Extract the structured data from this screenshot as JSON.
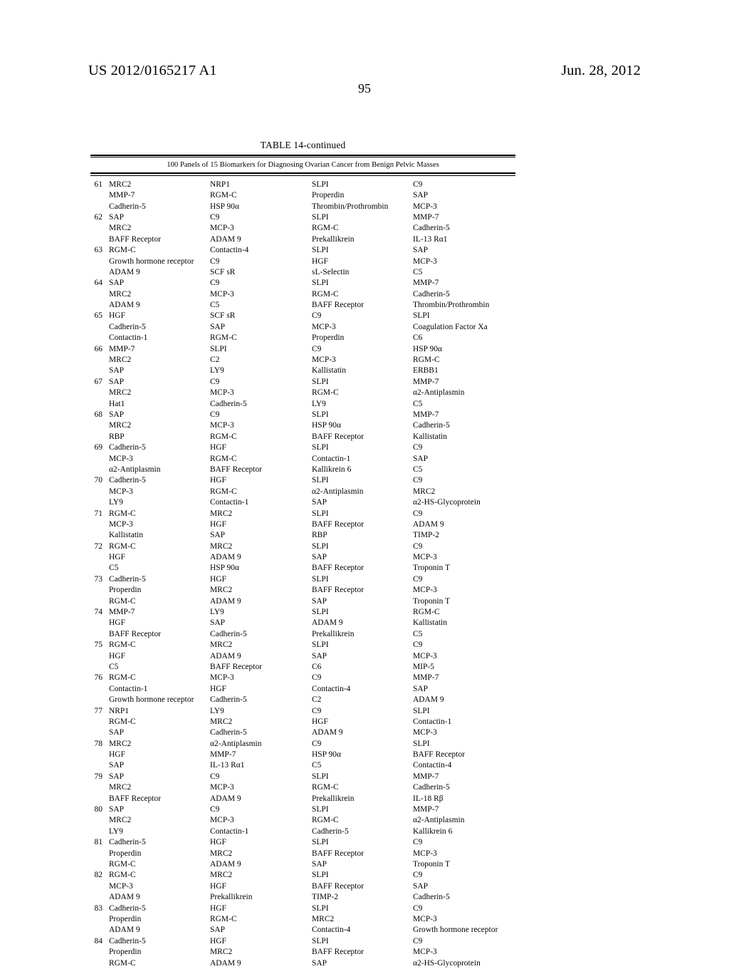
{
  "header": {
    "publication_number": "US 2012/0165217 A1",
    "publication_date": "Jun. 28, 2012",
    "page_number": "95"
  },
  "table": {
    "title": "TABLE 14-continued",
    "caption": "100 Panels of 15 Biomarkers for Diagnosing Ovarian Cancer from Benign Pelvic Masses",
    "panels": [
      {
        "index": "61",
        "lines": [
          [
            "MRC2",
            "NRP1",
            "SLPI",
            "C9"
          ],
          [
            "MMP-7",
            "RGM-C",
            "Properdin",
            "SAP"
          ],
          [
            "Cadherin-5",
            "HSP 90α",
            "Thrombin/Prothrombin",
            "MCP-3"
          ]
        ]
      },
      {
        "index": "62",
        "lines": [
          [
            "SAP",
            "C9",
            "SLPI",
            "MMP-7"
          ],
          [
            "MRC2",
            "MCP-3",
            "RGM-C",
            "Cadherin-5"
          ],
          [
            "BAFF Receptor",
            "ADAM 9",
            "Prekallikrein",
            "IL-13 Rα1"
          ]
        ]
      },
      {
        "index": "63",
        "lines": [
          [
            "RGM-C",
            "Contactin-4",
            "SLPI",
            "SAP"
          ],
          [
            "Growth hormone receptor",
            "C9",
            "HGF",
            "MCP-3"
          ],
          [
            "ADAM 9",
            "SCF sR",
            "sL-Selectin",
            "C5"
          ]
        ]
      },
      {
        "index": "64",
        "lines": [
          [
            "SAP",
            "C9",
            "SLPI",
            "MMP-7"
          ],
          [
            "MRC2",
            "MCP-3",
            "RGM-C",
            "Cadherin-5"
          ],
          [
            "ADAM 9",
            "C5",
            "BAFF Receptor",
            "Thrombin/Prothrombin"
          ]
        ]
      },
      {
        "index": "65",
        "lines": [
          [
            "HGF",
            "SCF sR",
            "C9",
            "SLPI"
          ],
          [
            "Cadherin-5",
            "SAP",
            "MCP-3",
            "Coagulation Factor Xa"
          ],
          [
            "Contactin-1",
            "RGM-C",
            "Properdin",
            "C6"
          ]
        ]
      },
      {
        "index": "66",
        "lines": [
          [
            "MMP-7",
            "SLPI",
            "C9",
            "HSP 90α"
          ],
          [
            "MRC2",
            "C2",
            "MCP-3",
            "RGM-C"
          ],
          [
            "SAP",
            "LY9",
            "Kallistatin",
            "ERBB1"
          ]
        ]
      },
      {
        "index": "67",
        "lines": [
          [
            "SAP",
            "C9",
            "SLPI",
            "MMP-7"
          ],
          [
            "MRC2",
            "MCP-3",
            "RGM-C",
            "α2-Antiplasmin"
          ],
          [
            "Hat1",
            "Cadherin-5",
            "LY9",
            "C5"
          ]
        ]
      },
      {
        "index": "68",
        "lines": [
          [
            "SAP",
            "C9",
            "SLPI",
            "MMP-7"
          ],
          [
            "MRC2",
            "MCP-3",
            "HSP 90α",
            "Cadherin-5"
          ],
          [
            "RBP",
            "RGM-C",
            "BAFF Receptor",
            "Kallistatin"
          ]
        ]
      },
      {
        "index": "69",
        "lines": [
          [
            "Cadherin-5",
            "HGF",
            "SLPI",
            "C9"
          ],
          [
            "MCP-3",
            "RGM-C",
            "Contactin-1",
            "SAP"
          ],
          [
            "α2-Antiplasmin",
            "BAFF Receptor",
            "Kallikrein 6",
            "C5"
          ]
        ]
      },
      {
        "index": "70",
        "lines": [
          [
            "Cadherin-5",
            "HGF",
            "SLPI",
            "C9"
          ],
          [
            "MCP-3",
            "RGM-C",
            "α2-Antiplasmin",
            "MRC2"
          ],
          [
            "LY9",
            "Contactin-1",
            "SAP",
            "α2-HS-Glycoprotein"
          ]
        ]
      },
      {
        "index": "71",
        "lines": [
          [
            "RGM-C",
            "MRC2",
            "SLPI",
            "C9"
          ],
          [
            "MCP-3",
            "HGF",
            "BAFF Receptor",
            "ADAM 9"
          ],
          [
            "Kallistatin",
            "SAP",
            "RBP",
            "TIMP-2"
          ]
        ]
      },
      {
        "index": "72",
        "lines": [
          [
            "RGM-C",
            "MRC2",
            "SLPI",
            "C9"
          ],
          [
            "HGF",
            "ADAM 9",
            "SAP",
            "MCP-3"
          ],
          [
            "C5",
            "HSP 90α",
            "BAFF Receptor",
            "Troponin T"
          ]
        ]
      },
      {
        "index": "73",
        "lines": [
          [
            "Cadherin-5",
            "HGF",
            "SLPI",
            "C9"
          ],
          [
            "Properdin",
            "MRC2",
            "BAFF Receptor",
            "MCP-3"
          ],
          [
            "RGM-C",
            "ADAM 9",
            "SAP",
            "Troponin T"
          ]
        ]
      },
      {
        "index": "74",
        "lines": [
          [
            "MMP-7",
            "LY9",
            "SLPI",
            "RGM-C"
          ],
          [
            "HGF",
            "SAP",
            "ADAM 9",
            "Kallistatin"
          ],
          [
            "BAFF Receptor",
            "Cadherin-5",
            "Prekallikrein",
            "C5"
          ]
        ]
      },
      {
        "index": "75",
        "lines": [
          [
            "RGM-C",
            "MRC2",
            "SLPI",
            "C9"
          ],
          [
            "HGF",
            "ADAM 9",
            "SAP",
            "MCP-3"
          ],
          [
            "C5",
            "BAFF Receptor",
            "C6",
            "MIP-5"
          ]
        ]
      },
      {
        "index": "76",
        "lines": [
          [
            "RGM-C",
            "MCP-3",
            "C9",
            "MMP-7"
          ],
          [
            "Contactin-1",
            "HGF",
            "Contactin-4",
            "SAP"
          ],
          [
            "Growth hormone receptor",
            "Cadherin-5",
            "C2",
            "ADAM 9"
          ]
        ]
      },
      {
        "index": "77",
        "lines": [
          [
            "NRP1",
            "LY9",
            "C9",
            "SLPI"
          ],
          [
            "RGM-C",
            "MRC2",
            "HGF",
            "Contactin-1"
          ],
          [
            "SAP",
            "Cadherin-5",
            "ADAM 9",
            "MCP-3"
          ]
        ]
      },
      {
        "index": "78",
        "lines": [
          [
            "MRC2",
            "α2-Antiplasmin",
            "C9",
            "SLPI"
          ],
          [
            "HGF",
            "MMP-7",
            "HSP 90α",
            "BAFF Receptor"
          ],
          [
            "SAP",
            "IL-13 Rα1",
            "C5",
            "Contactin-4"
          ]
        ]
      },
      {
        "index": "79",
        "lines": [
          [
            "SAP",
            "C9",
            "SLPI",
            "MMP-7"
          ],
          [
            "MRC2",
            "MCP-3",
            "RGM-C",
            "Cadherin-5"
          ],
          [
            "BAFF Receptor",
            "ADAM 9",
            "Prekallikrein",
            "IL-18 Rβ"
          ]
        ]
      },
      {
        "index": "80",
        "lines": [
          [
            "SAP",
            "C9",
            "SLPI",
            "MMP-7"
          ],
          [
            "MRC2",
            "MCP-3",
            "RGM-C",
            "α2-Antiplasmin"
          ],
          [
            "LY9",
            "Contactin-1",
            "Cadherin-5",
            "Kallikrein 6"
          ]
        ]
      },
      {
        "index": "81",
        "lines": [
          [
            "Cadherin-5",
            "HGF",
            "SLPI",
            "C9"
          ],
          [
            "Properdin",
            "MRC2",
            "BAFF Receptor",
            "MCP-3"
          ],
          [
            "RGM-C",
            "ADAM 9",
            "SAP",
            "Troponin T"
          ]
        ]
      },
      {
        "index": "82",
        "lines": [
          [
            "RGM-C",
            "MRC2",
            "SLPI",
            "C9"
          ],
          [
            "MCP-3",
            "HGF",
            "BAFF Receptor",
            "SAP"
          ],
          [
            "ADAM 9",
            "Prekallikrein",
            "TIMP-2",
            "Cadherin-5"
          ]
        ]
      },
      {
        "index": "83",
        "lines": [
          [
            "Cadherin-5",
            "HGF",
            "SLPI",
            "C9"
          ],
          [
            "Properdin",
            "RGM-C",
            "MRC2",
            "MCP-3"
          ],
          [
            "ADAM 9",
            "SAP",
            "Contactin-4",
            "Growth hormone receptor"
          ]
        ]
      },
      {
        "index": "84",
        "lines": [
          [
            "Cadherin-5",
            "HGF",
            "SLPI",
            "C9"
          ],
          [
            "Properdin",
            "MRC2",
            "BAFF Receptor",
            "MCP-3"
          ],
          [
            "RGM-C",
            "ADAM 9",
            "SAP",
            "α2-HS-Glycoprotein"
          ]
        ]
      }
    ]
  }
}
